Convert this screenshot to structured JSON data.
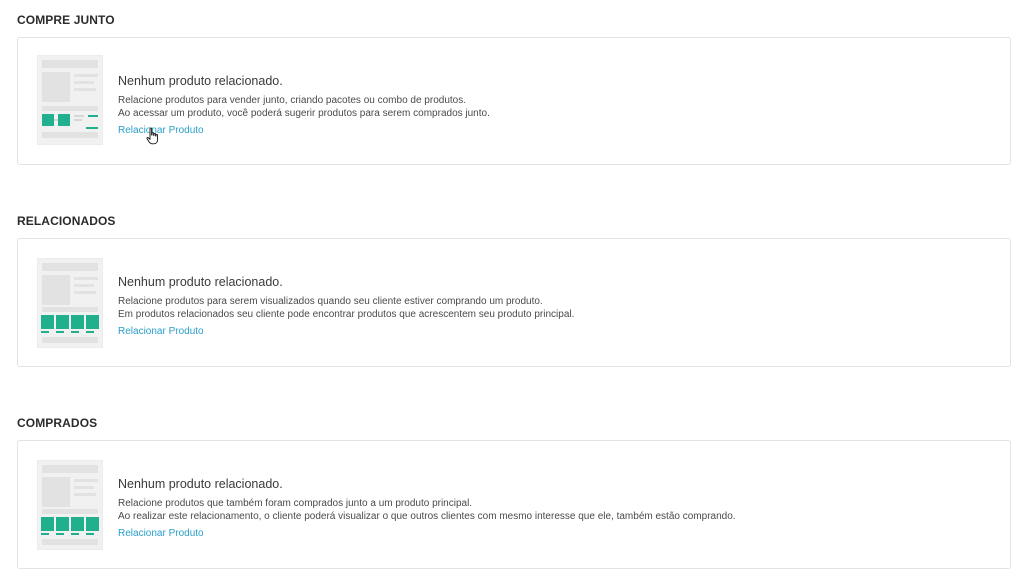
{
  "sections": [
    {
      "title": "COMPRE JUNTO",
      "empty_title": "Nenhum produto relacionado.",
      "description_line1": "Relacione produtos para vender junto, criando pacotes ou combo de produtos.",
      "description_line2": "Ao acessar um produto, você poderá sugerir produtos para serem comprados junto.",
      "link_label": "Relacionar Produto"
    },
    {
      "title": "RELACIONADOS",
      "empty_title": "Nenhum produto relacionado.",
      "description_line1": "Relacione produtos para serem visualizados quando seu cliente estiver comprando um produto.",
      "description_line2": "Em produtos relacionados seu cliente pode encontrar produtos que acrescentem seu produto principal.",
      "link_label": "Relacionar Produto"
    },
    {
      "title": "COMPRADOS",
      "empty_title": "Nenhum produto relacionado.",
      "description_line1": "Relacione produtos que também foram comprados junto a um produto principal.",
      "description_line2": "Ao realizar este relacionamento, o cliente poderá visualizar o que outros clientes com mesmo interesse que ele, também estão comprando.",
      "link_label": "Relacionar Produto"
    }
  ],
  "colors": {
    "accent_green": "#20b08e",
    "link_blue": "#2a9fc9",
    "border": "#e3e3e3"
  },
  "icons": {
    "cursor": "hand-pointer-icon"
  }
}
